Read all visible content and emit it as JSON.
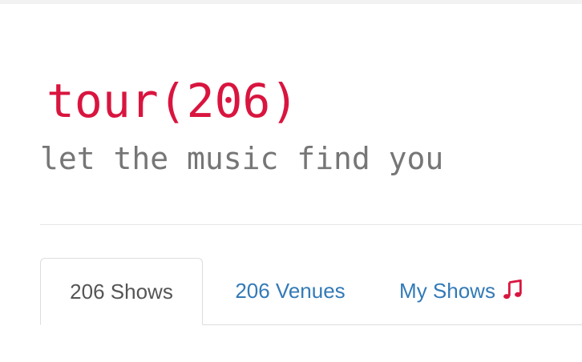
{
  "header": {
    "title": "tour(206)",
    "tagline": "let the music find you"
  },
  "tabs": [
    {
      "label": "206 Shows",
      "active": true
    },
    {
      "label": "206 Venues",
      "active": false
    },
    {
      "label": "My Shows",
      "active": false,
      "icon": "music-note-icon"
    }
  ],
  "colors": {
    "title": "#d9153f",
    "tagline": "#767676",
    "link": "#337ab7",
    "active_tab_text": "#555555",
    "icon": "#d9153f"
  }
}
